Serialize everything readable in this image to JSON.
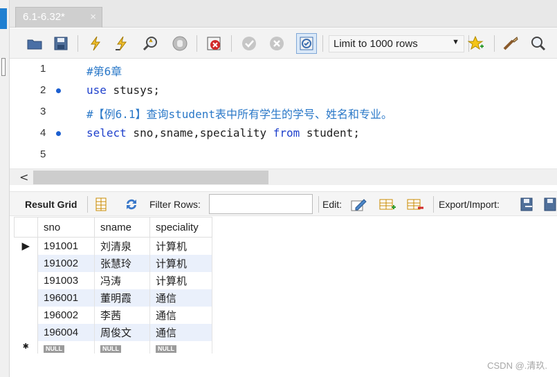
{
  "tab": {
    "title": "6.1-6.32*",
    "close_symbol": "×"
  },
  "toolbar": {
    "limit_label": "Limit to 1000 rows",
    "icons": [
      "open-folder-icon",
      "save-icon",
      "execute-icon",
      "execute-current-icon",
      "explain-icon",
      "stop-icon",
      "toggle-error-icon",
      "commit-icon",
      "rollback-icon",
      "autocommit-icon",
      "add-snippet-icon",
      "beautify-icon",
      "find-icon"
    ]
  },
  "editor": {
    "lines": [
      {
        "num": "1",
        "code": "#第6章",
        "type": "comment",
        "dot": false
      },
      {
        "num": "2",
        "kw": "use",
        "rest": " stusys;",
        "dot": true
      },
      {
        "num": "3",
        "code": "#【例6.1】查询student表中所有学生的学号、姓名和专业。",
        "type": "comment",
        "dot": false
      },
      {
        "num": "4",
        "kw": "select",
        "mid": " sno,sname,speciality ",
        "kw2": "from",
        "rest": " student;",
        "dot": true
      },
      {
        "num": "5",
        "code": "",
        "type": "plain",
        "dot": false
      }
    ]
  },
  "scrollbar": {
    "left_arrow": "<"
  },
  "results_toolbar": {
    "result_grid": "Result Grid",
    "filter_rows": "Filter Rows:",
    "edit": "Edit:",
    "export_import": "Export/Import:"
  },
  "grid": {
    "columns": [
      "sno",
      "sname",
      "speciality"
    ],
    "rows": [
      [
        "191001",
        "刘清泉",
        "计算机"
      ],
      [
        "191002",
        "张慧玲",
        "计算机"
      ],
      [
        "191003",
        "冯涛",
        "计算机"
      ],
      [
        "196001",
        "董明霞",
        "通信"
      ],
      [
        "196002",
        "李茜",
        "通信"
      ],
      [
        "196004",
        "周俊文",
        "通信"
      ]
    ],
    "null_label": "NULL",
    "current_row_marker": "▶",
    "new_row_marker": "✱"
  },
  "watermark": "CSDN @.清玖."
}
